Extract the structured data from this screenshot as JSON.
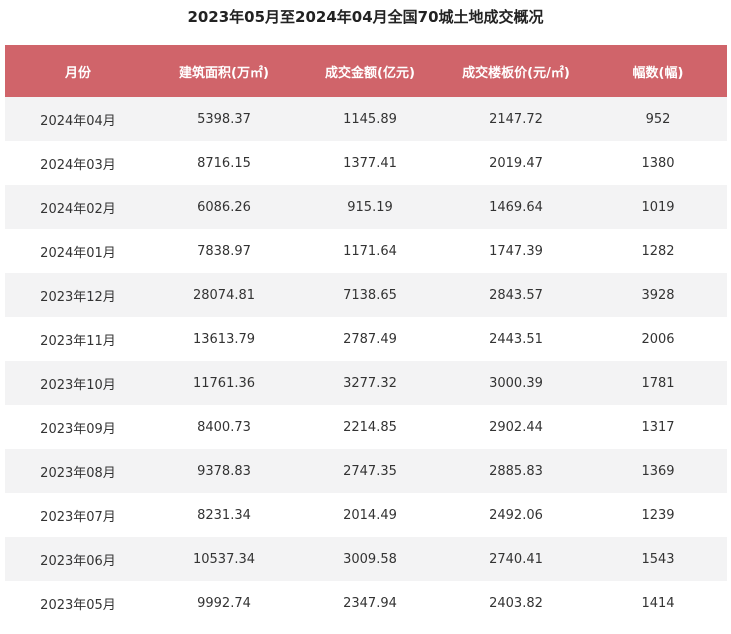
{
  "title": "2023年05月至2024年04月全国70城土地成交概况",
  "table": {
    "headers": [
      "月份",
      "建筑面积(万㎡)",
      "成交金额(亿元)",
      "成交楼板价(元/㎡)",
      "幅数(幅)"
    ],
    "rows": [
      [
        "2024年04月",
        "5398.37",
        "1145.89",
        "2147.72",
        "952"
      ],
      [
        "2024年03月",
        "8716.15",
        "1377.41",
        "2019.47",
        "1380"
      ],
      [
        "2024年02月",
        "6086.26",
        "915.19",
        "1469.64",
        "1019"
      ],
      [
        "2024年01月",
        "7838.97",
        "1171.64",
        "1747.39",
        "1282"
      ],
      [
        "2023年12月",
        "28074.81",
        "7138.65",
        "2843.57",
        "3928"
      ],
      [
        "2023年11月",
        "13613.79",
        "2787.49",
        "2443.51",
        "2006"
      ],
      [
        "2023年10月",
        "11761.36",
        "3277.32",
        "3000.39",
        "1781"
      ],
      [
        "2023年09月",
        "8400.73",
        "2214.85",
        "2902.44",
        "1317"
      ],
      [
        "2023年08月",
        "9378.83",
        "2747.35",
        "2885.83",
        "1369"
      ],
      [
        "2023年07月",
        "8231.34",
        "2014.49",
        "2492.06",
        "1239"
      ],
      [
        "2023年06月",
        "10537.34",
        "3009.58",
        "2740.41",
        "1543"
      ],
      [
        "2023年05月",
        "9992.74",
        "2347.94",
        "2403.82",
        "1414"
      ]
    ]
  },
  "colors": {
    "header_bg": "#d0646a",
    "header_text": "#ffffff",
    "row_stripe": "#f3f3f4"
  }
}
